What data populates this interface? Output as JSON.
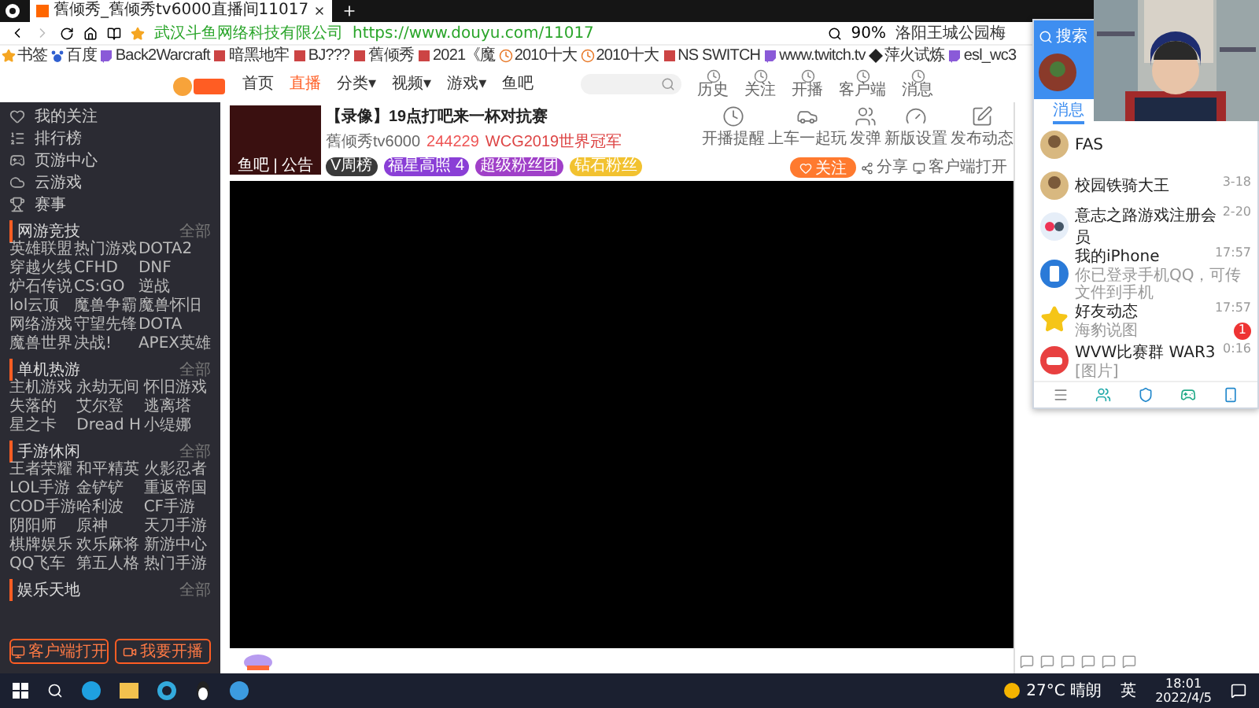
{
  "browser_tab": {
    "title": "舊倾秀_舊倾秀tv6000直播间11017",
    "selected": true
  },
  "address_bar": {
    "site": "武汉斗鱼网络科技有限公司",
    "url": "https://www.douyu.com/11017",
    "zoom": "90%",
    "news": "洛阳王城公园梅"
  },
  "bookmarks": [
    {
      "label": "书签",
      "kind": "star"
    },
    {
      "label": "百度",
      "kind": "paw"
    },
    {
      "label": "Back2Warcraft",
      "kind": "twitch"
    },
    {
      "label": "暗黑地牢",
      "kind": "page"
    },
    {
      "label": "BJ???",
      "kind": "page"
    },
    {
      "label": "舊倾秀",
      "kind": "page"
    },
    {
      "label": "2021《魔",
      "kind": "page"
    },
    {
      "label": "2010十大",
      "kind": "clock"
    },
    {
      "label": "2010十大",
      "kind": "clock"
    },
    {
      "label": "NS SWITCH",
      "kind": "page"
    },
    {
      "label": "www.twitch.tv",
      "kind": "twitch"
    },
    {
      "label": "萍火试炼",
      "kind": "diamond"
    },
    {
      "label": "esl_wc3",
      "kind": "twitch"
    }
  ],
  "site_nav": {
    "items": [
      {
        "label": "首页",
        "selected": false
      },
      {
        "label": "直播",
        "selected": true
      },
      {
        "label": "分类▾",
        "selected": false
      },
      {
        "label": "视频▾",
        "selected": false
      },
      {
        "label": "游戏▾",
        "selected": false
      },
      {
        "label": "鱼吧",
        "selected": false
      }
    ],
    "header_icons": [
      "历史",
      "关注",
      "开播",
      "客户端",
      "消息"
    ]
  },
  "sidebar": {
    "items": [
      "我的关注",
      "排行榜",
      "页游中心",
      "云游戏",
      "赛事"
    ],
    "sections": [
      {
        "title": "网游竞技",
        "more": "全部",
        "games": [
          "英雄联盟",
          "热门游戏",
          "DOTA2",
          "穿越火线",
          "CFHD",
          "DNF",
          "炉石传说",
          "CS:GO",
          "逆战",
          "lol云顶",
          "魔兽争霸",
          "魔兽怀旧",
          "网络游戏",
          "守望先锋",
          "DOTA",
          "魔兽世界",
          "决战!",
          "APEX英雄"
        ]
      },
      {
        "title": "单机热游",
        "more": "全部",
        "games": [
          "主机游戏",
          "永劫无间",
          "怀旧游戏",
          "失落的",
          "艾尔登",
          "逃离塔",
          "星之卡",
          "Dread H",
          "小缇娜"
        ]
      },
      {
        "title": "手游休闲",
        "more": "全部",
        "games": [
          "王者荣耀",
          "和平精英",
          "火影忍者",
          "LOL手游",
          "金铲铲",
          "重返帝国",
          "COD手游",
          "哈利波",
          "CF手游",
          "阴阳师",
          "原神",
          "天刀手游",
          "棋牌娱乐",
          "欢乐麻将",
          "新游中心",
          "QQ飞车",
          "第五人格",
          "热门手游"
        ]
      },
      {
        "title": "娱乐天地",
        "more": "全部"
      }
    ],
    "buttons": [
      "客户端打开",
      "我要开播"
    ]
  },
  "stream": {
    "title": "【录像】19点打吧来一杯对抗赛",
    "streamer": "舊倾秀tv6000",
    "heat": "244229",
    "honor": "WCG2019世界冠军",
    "avatar_caption": "鱼吧 | 公告",
    "badges": [
      {
        "label": "V周榜",
        "color": "#3a3a3a"
      },
      {
        "label": "福星高照 4",
        "color": "#8a3fd6"
      },
      {
        "label": "超级粉丝团",
        "color": "#a040c8"
      },
      {
        "label": "钻石粉丝",
        "color": "#f2c230"
      }
    ],
    "tools": [
      {
        "label": "开播提醒",
        "kind": "clock"
      },
      {
        "label": "上车一起玩",
        "kind": "car"
      },
      {
        "label": "发弹",
        "kind": "people"
      },
      {
        "label": "新版设置",
        "kind": "gauge"
      },
      {
        "label": "发布动态",
        "kind": "edit"
      }
    ],
    "follow": "关注",
    "share": "分享",
    "open_client": "客户端打开"
  },
  "qq": {
    "search": "搜索",
    "tab": "消息",
    "chats": [
      {
        "name": "FAS"
      },
      {
        "name": "校园铁骑大王",
        "time": "3-18"
      },
      {
        "name": "意志之路游戏注册会员",
        "time": "2-20",
        "kind": "group"
      },
      {
        "name": "我的iPhone",
        "time": "17:57",
        "preview": "你已登录手机QQ，可传文件到手机",
        "kind": "phone"
      },
      {
        "name": "好友动态",
        "time": "17:57",
        "preview": "海豹说图",
        "kind": "star",
        "unread": "1"
      },
      {
        "name": "WVW比赛群 WAR3",
        "time": "0:16",
        "preview": "[图片]",
        "kind": "game"
      }
    ]
  },
  "taskbar": {
    "weather": "27°C 晴朗",
    "ime": "英",
    "time": "18:01",
    "date": "2022/4/5"
  }
}
